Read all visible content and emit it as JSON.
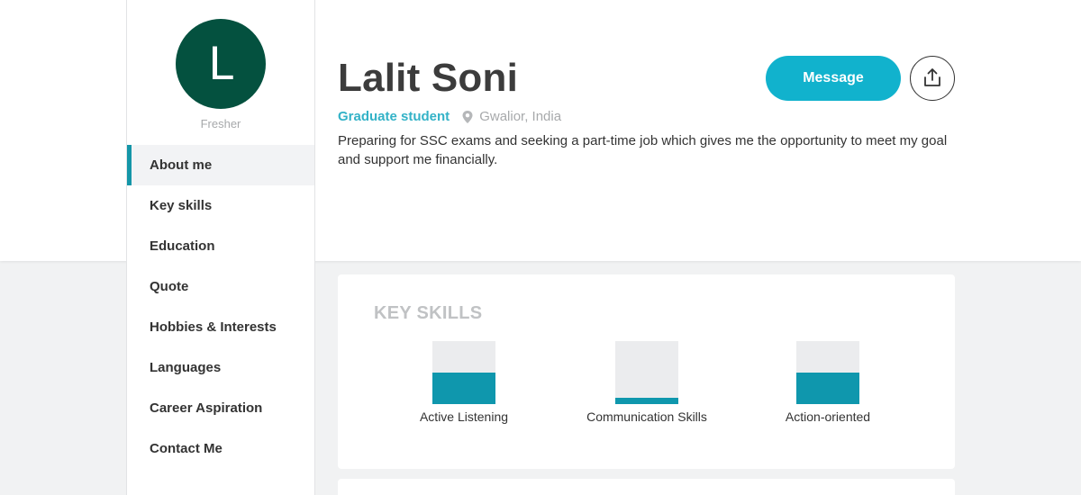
{
  "profile": {
    "initial": "L",
    "level": "Fresher",
    "name": "Lalit Soni",
    "role": "Graduate student",
    "location": "Gwalior, India",
    "bio": "Preparing for SSC exams and seeking a part-time job which gives me the opportunity to meet my goal and support me financially.",
    "avatar_color": "#04513f"
  },
  "actions": {
    "message_label": "Message",
    "share_icon": "share-icon"
  },
  "nav": {
    "items": [
      {
        "label": "About me",
        "active": true
      },
      {
        "label": "Key skills"
      },
      {
        "label": "Education"
      },
      {
        "label": "Quote"
      },
      {
        "label": "Hobbies & Interests"
      },
      {
        "label": "Languages"
      },
      {
        "label": "Career Aspiration"
      },
      {
        "label": "Contact Me"
      }
    ]
  },
  "key_skills": {
    "title": "KEY SKILLS",
    "skills": [
      {
        "label": "Active Listening",
        "level": 0.5
      },
      {
        "label": "Communication Skills",
        "level": 0.1
      },
      {
        "label": "Action-oriented",
        "level": 0.5
      }
    ]
  },
  "colors": {
    "accent": "#11b2cd",
    "skill_fill": "#0f97ad",
    "role_text": "#33b2c7"
  }
}
